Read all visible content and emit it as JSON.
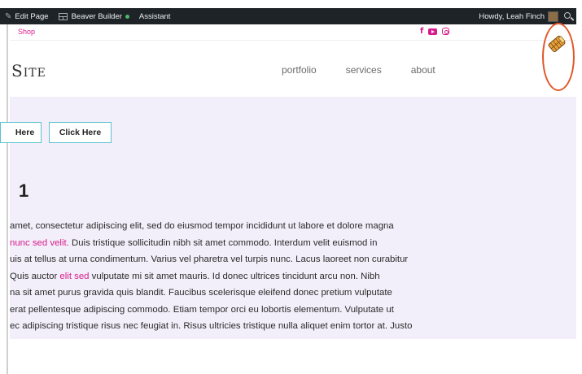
{
  "admin_bar": {
    "edit_page": "Edit Page",
    "beaver_builder": "Beaver Builder",
    "assistant": "Assistant",
    "howdy": "Howdy, Leah Finch"
  },
  "top_strip": {
    "shop": "Shop",
    "social_icons": [
      "facebook-icon",
      "youtube-icon",
      "instagram-icon"
    ]
  },
  "header": {
    "site_title": "Site",
    "nav": [
      "portfolio",
      "services",
      "about"
    ]
  },
  "content": {
    "buttons": [
      "Here",
      "Click Here"
    ],
    "heading": "1",
    "paragraph_lines": [
      [
        {
          "t": "amet, consectetur adipiscing elit, sed do eiusmod tempor incididunt ut labore et dolore magna"
        }
      ],
      [
        {
          "t": "nunc sed velit.",
          "link": true
        },
        {
          "t": " Duis tristique sollicitudin nibh sit amet commodo. Interdum velit euismod in"
        }
      ],
      [
        {
          "t": "uis at tellus at urna condimentum. Varius vel pharetra vel turpis nunc. Lacus laoreet non curabitur"
        }
      ],
      [
        {
          "t": "Quis auctor "
        },
        {
          "t": "elit sed",
          "link": true
        },
        {
          "t": " vulputate mi sit amet mauris. Id donec ultrices tincidunt arcu non. Nibh"
        }
      ],
      [
        {
          "t": "na sit amet purus gravida quis blandit. Faucibus scelerisque eleifend donec pretium vulputate"
        }
      ],
      [
        {
          "t": "erat pellentesque adipiscing commodo. Etiam tempor orci eu lobortis elementum. Vulputate ut"
        }
      ],
      [
        {
          "t": "ec adipiscing tristique risus nec feugiat in. Risus ultricies tristique nulla aliquet enim tortor at. Justo"
        }
      ]
    ]
  },
  "colors": {
    "accent": "#d81b8c",
    "button_border": "#5bc0ce",
    "content_bg": "#f3effa",
    "admin_bar_bg": "#1d2327",
    "annotation": "#e2572a"
  }
}
